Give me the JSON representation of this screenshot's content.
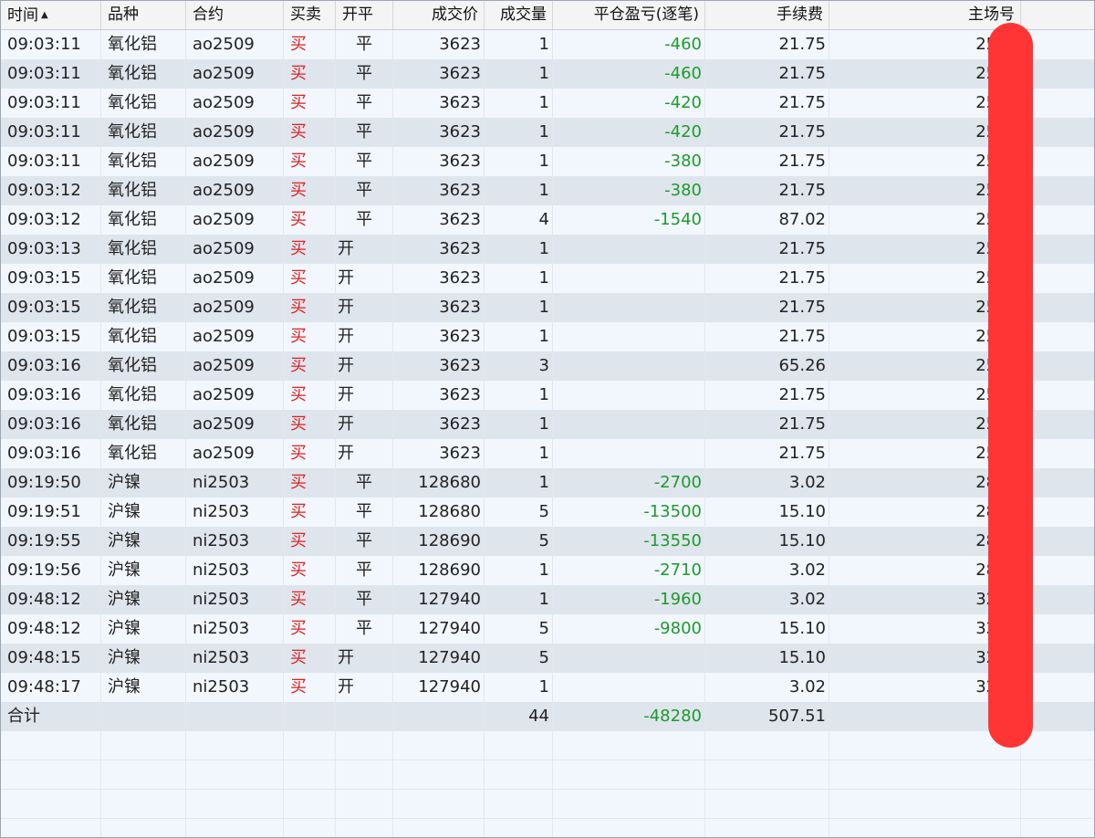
{
  "columns": [
    {
      "label": "时间",
      "sort": "▲"
    },
    {
      "label": "品种"
    },
    {
      "label": "合约"
    },
    {
      "label": "买卖"
    },
    {
      "label": "开平"
    },
    {
      "label": "成交价"
    },
    {
      "label": "成交量"
    },
    {
      "label": "平仓盈亏(逐笔)"
    },
    {
      "label": "手续费"
    },
    {
      "label": "主场号"
    }
  ],
  "rows": [
    {
      "time": "09:03:11",
      "product": "氧化铝",
      "contract": "ao2509",
      "side": "买",
      "oc": "平",
      "price": "3623",
      "qty": "1",
      "pnl": "-460",
      "fee": "21.75",
      "no": "2531"
    },
    {
      "time": "09:03:11",
      "product": "氧化铝",
      "contract": "ao2509",
      "side": "买",
      "oc": "平",
      "price": "3623",
      "qty": "1",
      "pnl": "-460",
      "fee": "21.75",
      "no": "2531"
    },
    {
      "time": "09:03:11",
      "product": "氧化铝",
      "contract": "ao2509",
      "side": "买",
      "oc": "平",
      "price": "3623",
      "qty": "1",
      "pnl": "-420",
      "fee": "21.75",
      "no": "2531"
    },
    {
      "time": "09:03:11",
      "product": "氧化铝",
      "contract": "ao2509",
      "side": "买",
      "oc": "平",
      "price": "3623",
      "qty": "1",
      "pnl": "-420",
      "fee": "21.75",
      "no": "2531"
    },
    {
      "time": "09:03:11",
      "product": "氧化铝",
      "contract": "ao2509",
      "side": "买",
      "oc": "平",
      "price": "3623",
      "qty": "1",
      "pnl": "-380",
      "fee": "21.75",
      "no": "2531"
    },
    {
      "time": "09:03:12",
      "product": "氧化铝",
      "contract": "ao2509",
      "side": "买",
      "oc": "平",
      "price": "3623",
      "qty": "1",
      "pnl": "-380",
      "fee": "21.75",
      "no": "2532"
    },
    {
      "time": "09:03:12",
      "product": "氧化铝",
      "contract": "ao2509",
      "side": "买",
      "oc": "平",
      "price": "3623",
      "qty": "4",
      "pnl": "-1540",
      "fee": "87.02",
      "no": "2532"
    },
    {
      "time": "09:03:13",
      "product": "氧化铝",
      "contract": "ao2509",
      "side": "买",
      "oc": "开",
      "price": "3623",
      "qty": "1",
      "pnl": "",
      "fee": "21.75",
      "no": "2533"
    },
    {
      "time": "09:03:15",
      "product": "氧化铝",
      "contract": "ao2509",
      "side": "买",
      "oc": "开",
      "price": "3623",
      "qty": "1",
      "pnl": "",
      "fee": "21.75",
      "no": "2533"
    },
    {
      "time": "09:03:15",
      "product": "氧化铝",
      "contract": "ao2509",
      "side": "买",
      "oc": "开",
      "price": "3623",
      "qty": "1",
      "pnl": "",
      "fee": "21.75",
      "no": "2533"
    },
    {
      "time": "09:03:15",
      "product": "氧化铝",
      "contract": "ao2509",
      "side": "买",
      "oc": "开",
      "price": "3623",
      "qty": "1",
      "pnl": "",
      "fee": "21.75",
      "no": "2534"
    },
    {
      "time": "09:03:16",
      "product": "氧化铝",
      "contract": "ao2509",
      "side": "买",
      "oc": "开",
      "price": "3623",
      "qty": "3",
      "pnl": "",
      "fee": "65.26",
      "no": "2534"
    },
    {
      "time": "09:03:16",
      "product": "氧化铝",
      "contract": "ao2509",
      "side": "买",
      "oc": "开",
      "price": "3623",
      "qty": "1",
      "pnl": "",
      "fee": "21.75",
      "no": "2534"
    },
    {
      "time": "09:03:16",
      "product": "氧化铝",
      "contract": "ao2509",
      "side": "买",
      "oc": "开",
      "price": "3623",
      "qty": "1",
      "pnl": "",
      "fee": "21.75",
      "no": "2534"
    },
    {
      "time": "09:03:16",
      "product": "氧化铝",
      "contract": "ao2509",
      "side": "买",
      "oc": "开",
      "price": "3623",
      "qty": "1",
      "pnl": "",
      "fee": "21.75",
      "no": "2534"
    },
    {
      "time": "09:19:50",
      "product": "沪镍",
      "contract": "ni2503",
      "side": "买",
      "oc": "平",
      "price": "128680",
      "qty": "1",
      "pnl": "-2700",
      "fee": "3.02",
      "no": "2870"
    },
    {
      "time": "09:19:51",
      "product": "沪镍",
      "contract": "ni2503",
      "side": "买",
      "oc": "平",
      "price": "128680",
      "qty": "5",
      "pnl": "-13500",
      "fee": "15.10",
      "no": "2870"
    },
    {
      "time": "09:19:55",
      "product": "沪镍",
      "contract": "ni2503",
      "side": "买",
      "oc": "平",
      "price": "128690",
      "qty": "5",
      "pnl": "-13550",
      "fee": "15.10",
      "no": "2871"
    },
    {
      "time": "09:19:56",
      "product": "沪镍",
      "contract": "ni2503",
      "side": "买",
      "oc": "平",
      "price": "128690",
      "qty": "1",
      "pnl": "-2710",
      "fee": "3.02",
      "no": "2872"
    },
    {
      "time": "09:48:12",
      "product": "沪镍",
      "contract": "ni2503",
      "side": "买",
      "oc": "平",
      "price": "127940",
      "qty": "1",
      "pnl": "-1960",
      "fee": "3.02",
      "no": "3244"
    },
    {
      "time": "09:48:12",
      "product": "沪镍",
      "contract": "ni2503",
      "side": "买",
      "oc": "平",
      "price": "127940",
      "qty": "5",
      "pnl": "-9800",
      "fee": "15.10",
      "no": "3244"
    },
    {
      "time": "09:48:15",
      "product": "沪镍",
      "contract": "ni2503",
      "side": "买",
      "oc": "开",
      "price": "127940",
      "qty": "5",
      "pnl": "",
      "fee": "15.10",
      "no": "3245"
    },
    {
      "time": "09:48:17",
      "product": "沪镍",
      "contract": "ni2503",
      "side": "买",
      "oc": "开",
      "price": "127940",
      "qty": "1",
      "pnl": "",
      "fee": "3.02",
      "no": "3245"
    }
  ],
  "totals": {
    "label": "合计",
    "qty": "44",
    "pnl": "-48280",
    "fee": "507.51"
  },
  "colors": {
    "buy": "#e02020",
    "pnl": "#1d9a2d",
    "redaction": "#ff3535"
  }
}
